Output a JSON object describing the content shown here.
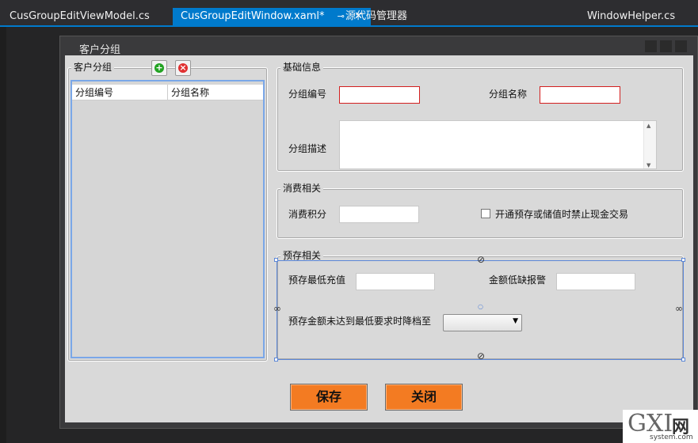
{
  "tabs": [
    {
      "label": "CusGroupEditViewModel.cs"
    },
    {
      "label": "CusGroupEditWindow.xaml*"
    },
    {
      "label": "源代码管理器"
    },
    {
      "label": "WindowHelper.cs"
    }
  ],
  "window": {
    "title": "客户分组"
  },
  "group_list": {
    "title": "客户分组",
    "columns": [
      "分组编号",
      "分组名称"
    ]
  },
  "basic_info": {
    "title": "基础信息",
    "group_no_label": "分组编号",
    "group_name_label": "分组名称",
    "group_desc_label": "分组描述"
  },
  "consumption": {
    "title": "消费相关",
    "points_label": "消费积分",
    "checkbox_label": "开通预存或储值时禁止现金交易"
  },
  "prepaid": {
    "title": "预存相关",
    "min_recharge_label": "预存最低充值",
    "low_balance_label": "金额低缺报警",
    "downgrade_label": "预存金额未达到最低要求时降档至"
  },
  "buttons": {
    "save": "保存",
    "close": "关闭"
  },
  "watermark": {
    "logo": "GXI",
    "wang": "网",
    "site": "system.com"
  },
  "colors": {
    "accent": "#007acc",
    "button": "#f37b22",
    "required_border": "#d31f1f"
  }
}
